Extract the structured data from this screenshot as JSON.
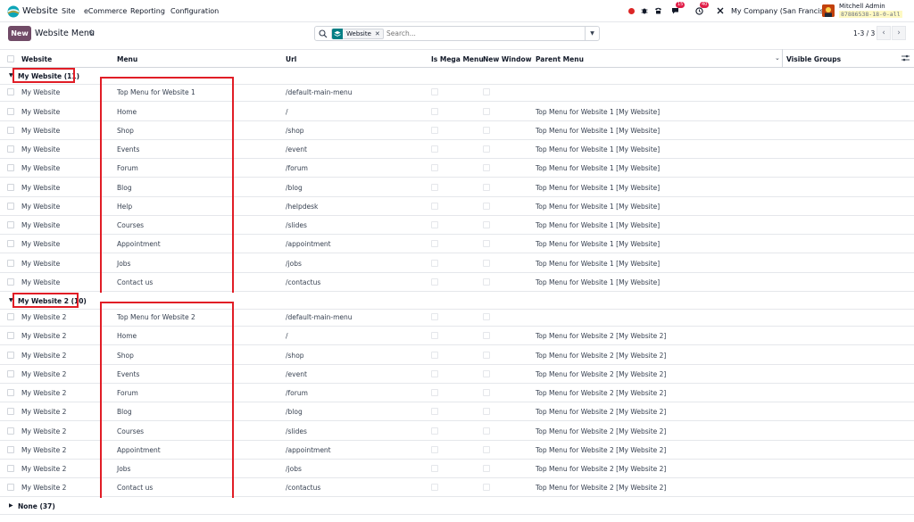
{
  "navbar": {
    "app_name": "Website",
    "menus": [
      "Site",
      "eCommerce",
      "Reporting",
      "Configuration"
    ],
    "messages_count": "15",
    "activities_count": "40",
    "company": "My Company (San Francisco)",
    "user": "Mitchell Admin",
    "database": "87886538-18-0-all"
  },
  "control": {
    "new_label": "New",
    "title": "Website Menu",
    "facet_label": "Website",
    "search_placeholder": "Search...",
    "pager": "1-3 / 3"
  },
  "columns": {
    "website": "Website",
    "menu": "Menu",
    "url": "Url",
    "mega": "Is Mega Menu",
    "new_window": "New Window",
    "parent": "Parent Menu",
    "groups": "Visible Groups"
  },
  "groups": [
    {
      "label": "My Website (11)",
      "rows": [
        {
          "website": "My Website",
          "menu": "Top Menu for Website 1",
          "url": "/default-main-menu",
          "parent": ""
        },
        {
          "website": "My Website",
          "menu": "Home",
          "url": "/",
          "parent": "Top Menu for Website 1 [My Website]"
        },
        {
          "website": "My Website",
          "menu": "Shop",
          "url": "/shop",
          "parent": "Top Menu for Website 1 [My Website]"
        },
        {
          "website": "My Website",
          "menu": "Events",
          "url": "/event",
          "parent": "Top Menu for Website 1 [My Website]"
        },
        {
          "website": "My Website",
          "menu": "Forum",
          "url": "/forum",
          "parent": "Top Menu for Website 1 [My Website]"
        },
        {
          "website": "My Website",
          "menu": "Blog",
          "url": "/blog",
          "parent": "Top Menu for Website 1 [My Website]"
        },
        {
          "website": "My Website",
          "menu": "Help",
          "url": "/helpdesk",
          "parent": "Top Menu for Website 1 [My Website]"
        },
        {
          "website": "My Website",
          "menu": "Courses",
          "url": "/slides",
          "parent": "Top Menu for Website 1 [My Website]"
        },
        {
          "website": "My Website",
          "menu": "Appointment",
          "url": "/appointment",
          "parent": "Top Menu for Website 1 [My Website]"
        },
        {
          "website": "My Website",
          "menu": "Jobs",
          "url": "/jobs",
          "parent": "Top Menu for Website 1 [My Website]"
        },
        {
          "website": "My Website",
          "menu": "Contact us",
          "url": "/contactus",
          "parent": "Top Menu for Website 1 [My Website]"
        }
      ]
    },
    {
      "label": "My Website 2 (10)",
      "rows": [
        {
          "website": "My Website 2",
          "menu": "Top Menu for Website 2",
          "url": "/default-main-menu",
          "parent": ""
        },
        {
          "website": "My Website 2",
          "menu": "Home",
          "url": "/",
          "parent": "Top Menu for Website 2 [My Website 2]"
        },
        {
          "website": "My Website 2",
          "menu": "Shop",
          "url": "/shop",
          "parent": "Top Menu for Website 2 [My Website 2]"
        },
        {
          "website": "My Website 2",
          "menu": "Events",
          "url": "/event",
          "parent": "Top Menu for Website 2 [My Website 2]"
        },
        {
          "website": "My Website 2",
          "menu": "Forum",
          "url": "/forum",
          "parent": "Top Menu for Website 2 [My Website 2]"
        },
        {
          "website": "My Website 2",
          "menu": "Blog",
          "url": "/blog",
          "parent": "Top Menu for Website 2 [My Website 2]"
        },
        {
          "website": "My Website 2",
          "menu": "Courses",
          "url": "/slides",
          "parent": "Top Menu for Website 2 [My Website 2]"
        },
        {
          "website": "My Website 2",
          "menu": "Appointment",
          "url": "/appointment",
          "parent": "Top Menu for Website 2 [My Website 2]"
        },
        {
          "website": "My Website 2",
          "menu": "Jobs",
          "url": "/jobs",
          "parent": "Top Menu for Website 2 [My Website 2]"
        },
        {
          "website": "My Website 2",
          "menu": "Contact us",
          "url": "/contactus",
          "parent": "Top Menu for Website 2 [My Website 2]"
        }
      ]
    },
    {
      "label": "None (37)",
      "rows": []
    }
  ],
  "colors": {
    "brand": "#714b67",
    "highlight": "#e11d26",
    "facet": "#017e84"
  }
}
